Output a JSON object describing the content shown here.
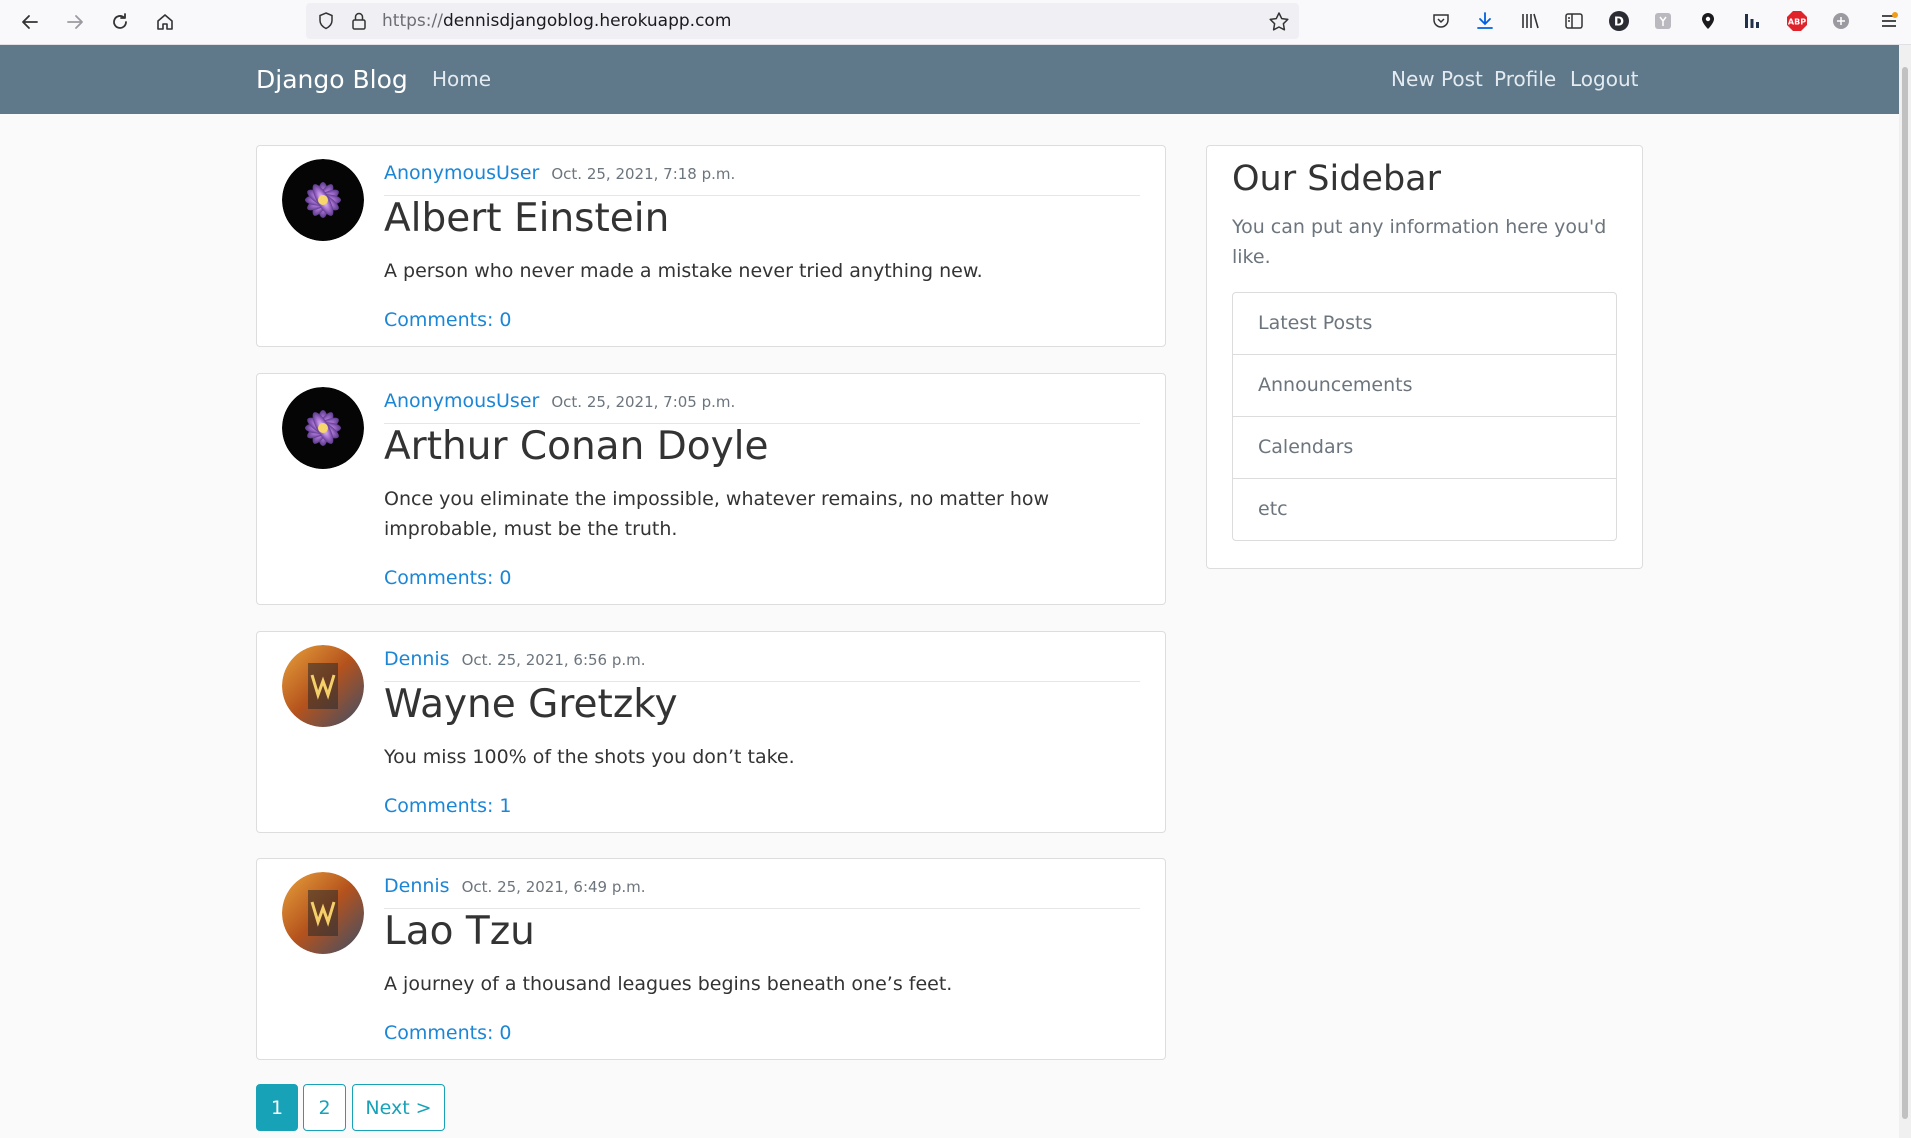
{
  "browser": {
    "url_protocol": "https://",
    "url_host": "dennisdjangoblog.herokuapp.com",
    "profile_letter": "D",
    "abp_label": "ABP"
  },
  "navbar": {
    "brand": "Django Blog",
    "home": "Home",
    "new_post": "New Post",
    "profile": "Profile",
    "logout": "Logout",
    "background_color": "#5f788a"
  },
  "posts": [
    {
      "author": "AnonymousUser",
      "date": "Oct. 25, 2021, 7:18 p.m.",
      "title": "Albert Einstein",
      "content": "A person who never made a mistake never tried anything new.",
      "comments": "Comments: 0",
      "avatar": "flower"
    },
    {
      "author": "AnonymousUser",
      "date": "Oct. 25, 2021, 7:05 p.m.",
      "title": "Arthur Conan Doyle",
      "content": "Once you eliminate the impossible, whatever remains, no matter how improbable, must be the truth.",
      "comments": "Comments: 0",
      "avatar": "flower"
    },
    {
      "author": "Dennis",
      "date": "Oct. 25, 2021, 6:56 p.m.",
      "title": "Wayne Gretzky",
      "content": "You miss 100% of the shots you don’t take.",
      "comments": "Comments: 1",
      "avatar": "comic"
    },
    {
      "author": "Dennis",
      "date": "Oct. 25, 2021, 6:49 p.m.",
      "title": "Lao Tzu",
      "content": "A journey of a thousand leagues begins beneath one’s feet.",
      "comments": "Comments: 0",
      "avatar": "comic"
    }
  ],
  "sidebar": {
    "title": "Our Sidebar",
    "subtitle": "You can put any information here you'd like.",
    "items": [
      "Latest Posts",
      "Announcements",
      "Calendars",
      "etc"
    ]
  },
  "pagination": {
    "pages": [
      "1",
      "2"
    ],
    "current": "1",
    "next": "Next >",
    "accent_color": "#17a2b8"
  },
  "colors": {
    "link": "#1b86d6"
  }
}
